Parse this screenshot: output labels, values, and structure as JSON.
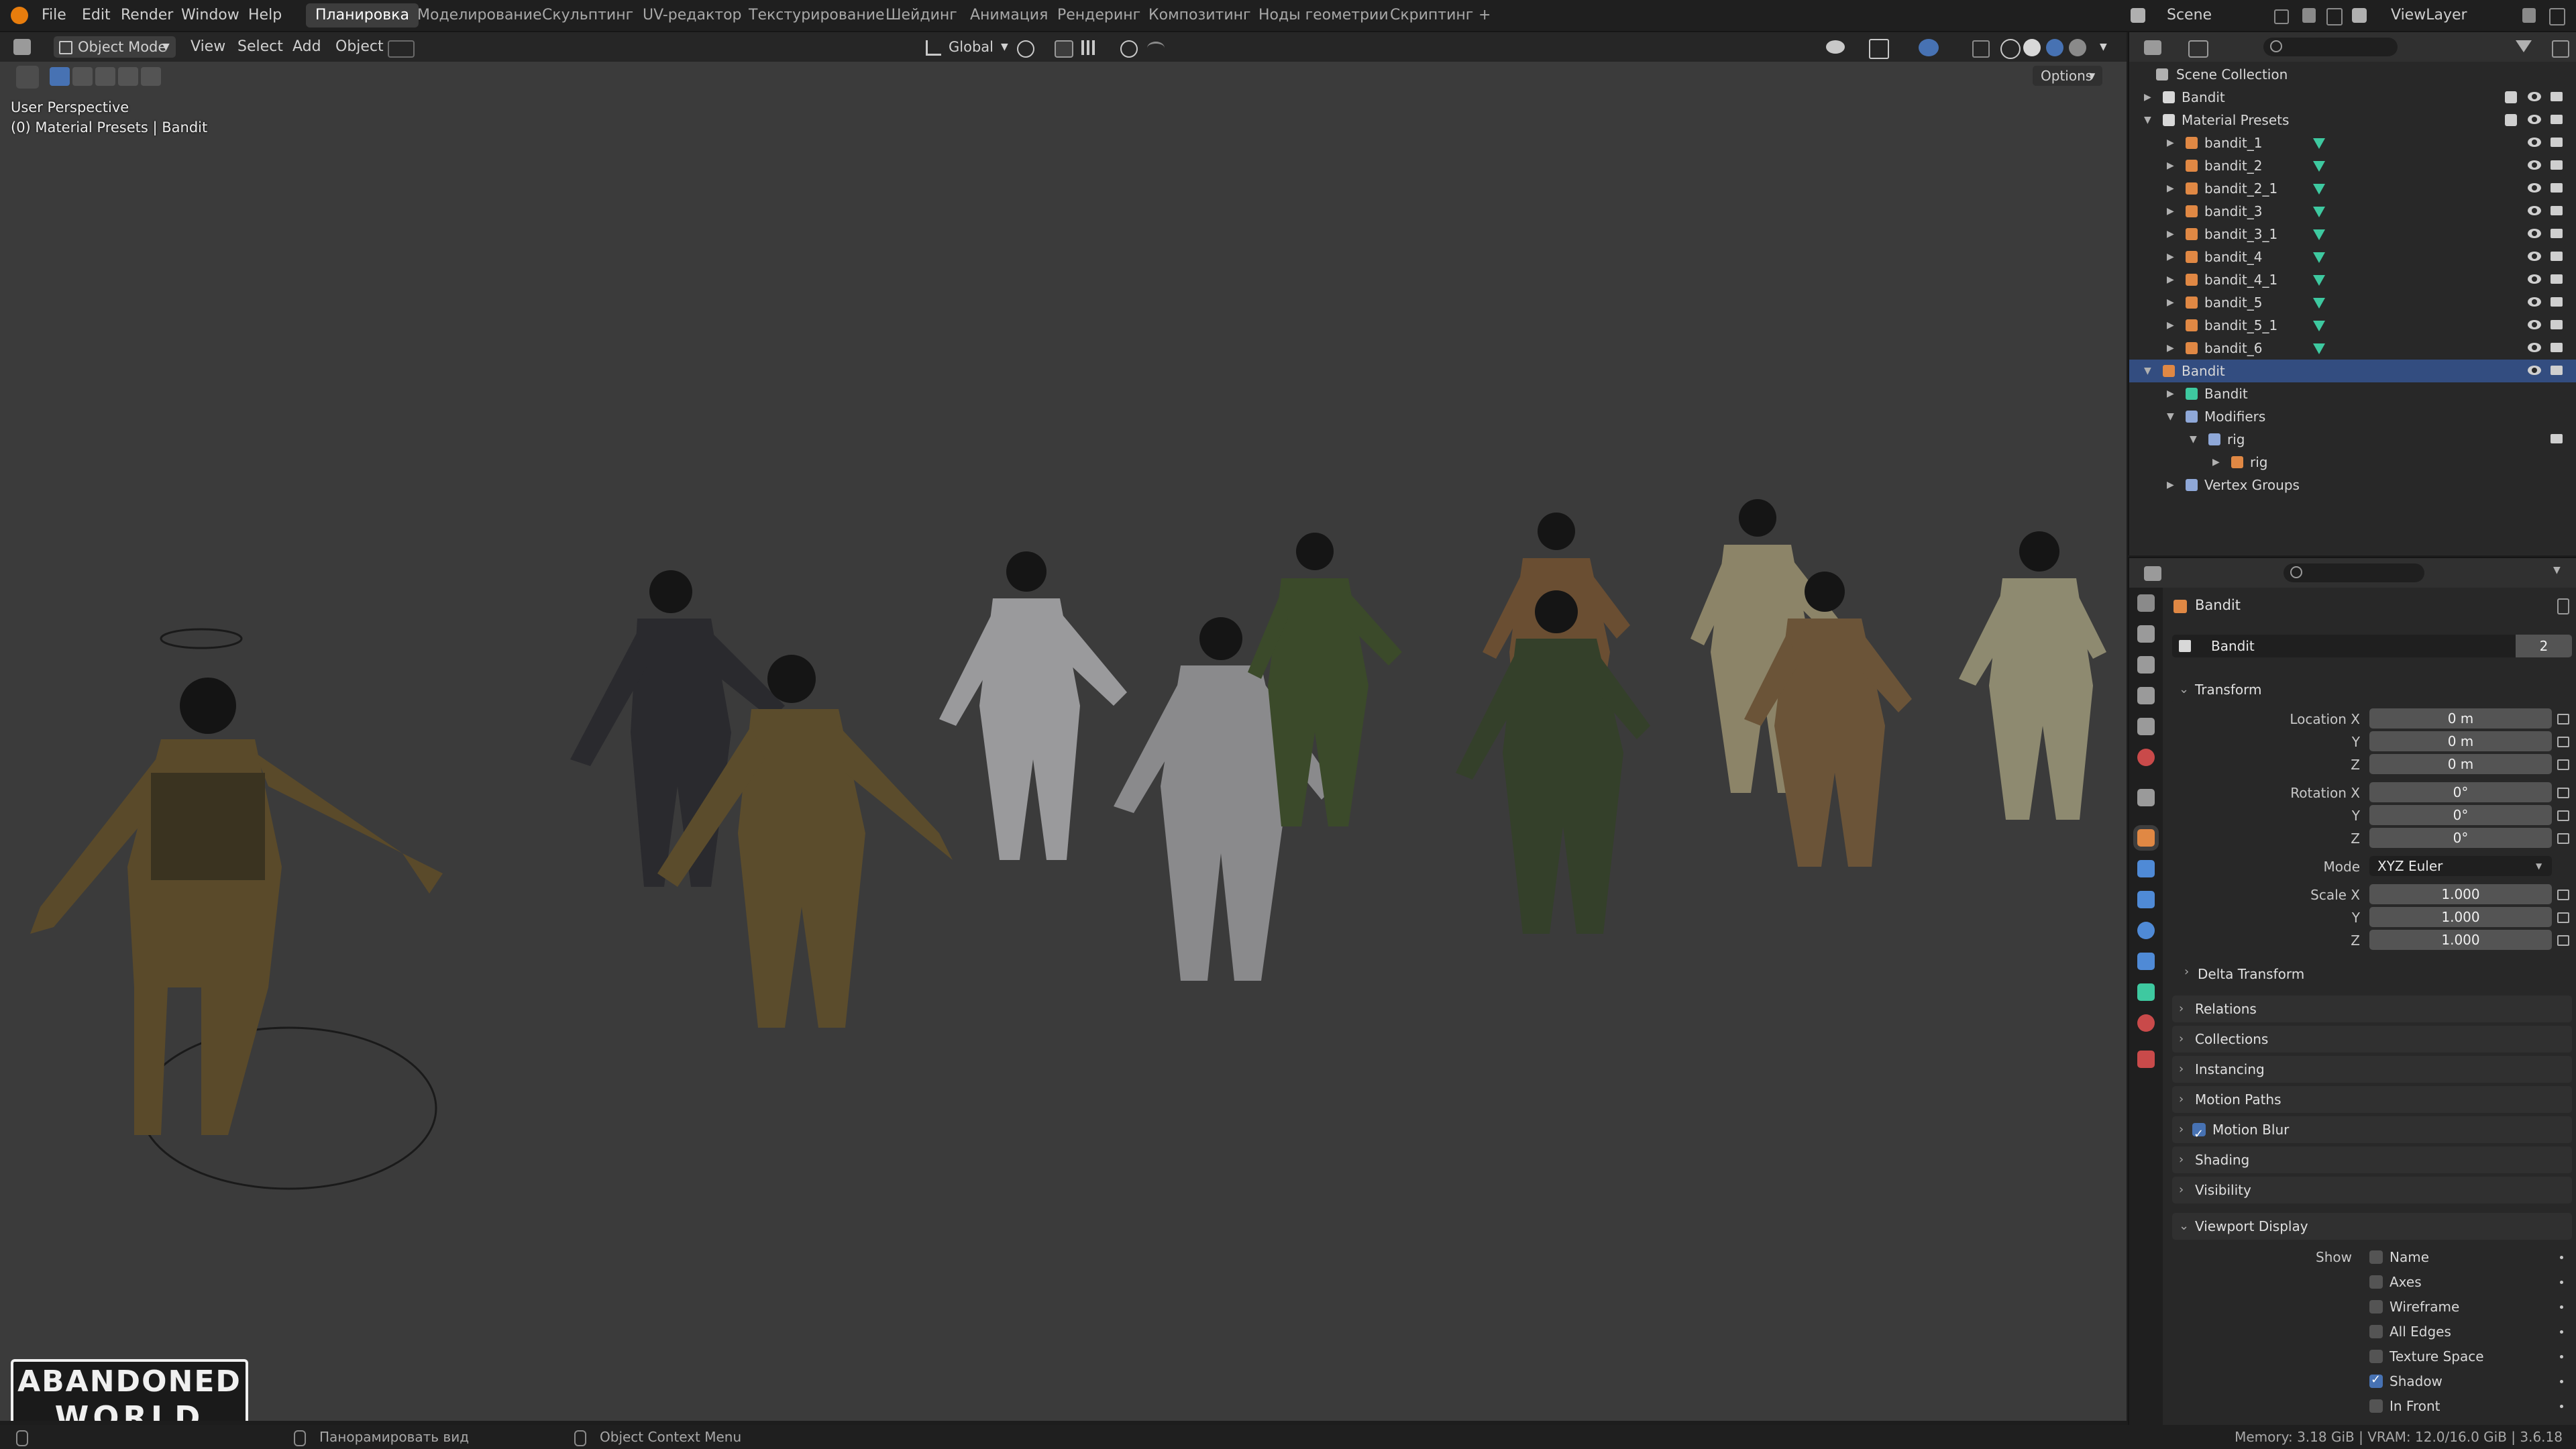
{
  "topbar": {
    "menu": [
      "File",
      "Edit",
      "Render",
      "Window",
      "Help"
    ],
    "workspaces": [
      "Планировка",
      "Моделирование",
      "Скульптинг",
      "UV-редактор",
      "Текстурирование",
      "Шейдинг",
      "Анимация",
      "Рендеринг",
      "Композитинг",
      "Ноды геометрии",
      "Скриптинг"
    ],
    "add_tab": "+",
    "scene": "Scene",
    "view_layer": "ViewLayer"
  },
  "viewport_header": {
    "mode": "Object Mode",
    "menus": [
      "View",
      "Select",
      "Add",
      "Object"
    ],
    "orientation": "Global",
    "options": "Options"
  },
  "viewport": {
    "perspective": "User Perspective",
    "context": "(0) Material Presets | Bandit",
    "logo_line1": "ABANDONED",
    "logo_line2": "WORLD"
  },
  "outliner": {
    "root": "Scene Collection",
    "rows": [
      {
        "label": "Bandit",
        "level": 1,
        "expanded": false,
        "icon": "collection-icon"
      },
      {
        "label": "Material Presets",
        "level": 1,
        "expanded": true,
        "icon": "collection-icon"
      },
      {
        "label": "bandit_1",
        "level": 2,
        "icon": "mesh-object-icon"
      },
      {
        "label": "bandit_2",
        "level": 2,
        "icon": "mesh-object-icon"
      },
      {
        "label": "bandit_2_1",
        "level": 2,
        "icon": "mesh-object-icon"
      },
      {
        "label": "bandit_3",
        "level": 2,
        "icon": "mesh-object-icon"
      },
      {
        "label": "bandit_3_1",
        "level": 2,
        "icon": "mesh-object-icon"
      },
      {
        "label": "bandit_4",
        "level": 2,
        "icon": "mesh-object-icon"
      },
      {
        "label": "bandit_4_1",
        "level": 2,
        "icon": "mesh-object-icon"
      },
      {
        "label": "bandit_5",
        "level": 2,
        "icon": "mesh-object-icon"
      },
      {
        "label": "bandit_5_1",
        "level": 2,
        "icon": "mesh-object-icon"
      },
      {
        "label": "bandit_6",
        "level": 2,
        "icon": "mesh-object-icon"
      },
      {
        "label": "Bandit",
        "level": 1,
        "expanded": true,
        "icon": "mesh-object-icon",
        "selected": true
      },
      {
        "label": "Bandit",
        "level": 2,
        "icon": "mesh-data-icon"
      },
      {
        "label": "Modifiers",
        "level": 2,
        "expanded": true,
        "icon": "wrench-icon"
      },
      {
        "label": "rig",
        "level": 3,
        "expanded": true,
        "icon": "armature-modifier-icon"
      },
      {
        "label": "rig",
        "level": 4,
        "icon": "armature-object-icon"
      },
      {
        "label": "Vertex Groups",
        "level": 2,
        "icon": "vertex-groups-icon"
      }
    ]
  },
  "properties": {
    "object_name": "Bandit",
    "data_name": "Bandit",
    "users": "2",
    "transform": {
      "title": "Transform",
      "location_label": "Location X",
      "y_label": "Y",
      "z_label": "Z",
      "location": [
        "0 m",
        "0 m",
        "0 m"
      ],
      "rotation_label": "Rotation X",
      "rotation": [
        "0°",
        "0°",
        "0°"
      ],
      "mode_label": "Mode",
      "mode": "XYZ Euler",
      "scale_label": "Scale X",
      "scale": [
        "1.000",
        "1.000",
        "1.000"
      ]
    },
    "delta_transform": "Delta Transform",
    "panels": [
      "Relations",
      "Collections",
      "Instancing",
      "Motion Paths",
      "Motion Blur",
      "Shading",
      "Visibility"
    ],
    "viewport_display": {
      "title": "Viewport Display",
      "show_label": "Show",
      "options": [
        {
          "label": "Name",
          "checked": false
        },
        {
          "label": "Axes",
          "checked": false
        },
        {
          "label": "Wireframe",
          "checked": false
        },
        {
          "label": "All Edges",
          "checked": false
        },
        {
          "label": "Texture Space",
          "checked": false
        },
        {
          "label": "Shadow",
          "checked": true
        },
        {
          "label": "In Front",
          "checked": false
        }
      ]
    }
  },
  "statusbar": {
    "pan": "Панорамировать вид",
    "context_menu": "Object Context Menu",
    "memory": "Memory: 3.18 GiB | VRAM: 12.0/16.0 GiB | 3.6.18"
  },
  "colors": {
    "accent": "#4772b3",
    "viewport_bg": "#3b3b3b",
    "object_icon": "#e08844",
    "mesh_icon": "#3ec9a0",
    "selected_row": "#334d80"
  }
}
